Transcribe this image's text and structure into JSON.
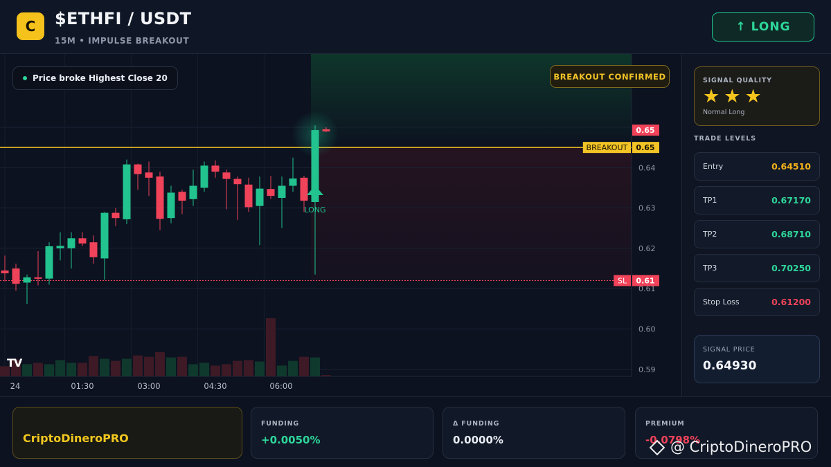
{
  "header": {
    "logo_letter": "C",
    "pair": "$ETHFI / USDT",
    "subtitle": "15M • IMPULSE BREAKOUT",
    "action_label": "↑ LONG"
  },
  "chart_overlay": {
    "info_pill": "Price broke Highest Close 20",
    "confirm_pill": "BREAKOUT CONFIRMED",
    "tv_logo": "TV"
  },
  "chart_data": {
    "type": "candlestick",
    "y_ticks": [
      "0.65",
      "0.64",
      "0.63",
      "0.62",
      "0.61",
      "0.60",
      "0.59"
    ],
    "x_ticks": [
      "24",
      "01:30",
      "03:00",
      "04:30",
      "06:00"
    ],
    "ylim": [
      0.5874,
      0.6584
    ],
    "breakout_level": 0.645,
    "stop_level": 0.612,
    "price_tags": [
      {
        "label": "",
        "value": "0.65",
        "color": "#f0435a",
        "price": 0.6493
      },
      {
        "label": "BREAKOUT",
        "value": "0.65",
        "color": "#f2c426",
        "price": 0.645
      },
      {
        "label": "SL",
        "value": "0.61",
        "color": "#f0435a",
        "price": 0.612
      }
    ],
    "signal_marker": {
      "label": "LONG",
      "candle_index": 28
    },
    "candles": [
      {
        "o": 0.6145,
        "h": 0.6182,
        "l": 0.6118,
        "c": 0.6138
      },
      {
        "o": 0.615,
        "h": 0.6162,
        "l": 0.6095,
        "c": 0.6112
      },
      {
        "o": 0.6115,
        "h": 0.6135,
        "l": 0.6062,
        "c": 0.6128
      },
      {
        "o": 0.6128,
        "h": 0.6193,
        "l": 0.6108,
        "c": 0.6125
      },
      {
        "o": 0.6125,
        "h": 0.6215,
        "l": 0.611,
        "c": 0.6205
      },
      {
        "o": 0.62,
        "h": 0.624,
        "l": 0.617,
        "c": 0.6206
      },
      {
        "o": 0.62,
        "h": 0.624,
        "l": 0.615,
        "c": 0.6225
      },
      {
        "o": 0.6225,
        "h": 0.624,
        "l": 0.6205,
        "c": 0.6212
      },
      {
        "o": 0.6215,
        "h": 0.6232,
        "l": 0.6162,
        "c": 0.6178
      },
      {
        "o": 0.6175,
        "h": 0.629,
        "l": 0.6122,
        "c": 0.6288
      },
      {
        "o": 0.6288,
        "h": 0.63,
        "l": 0.6255,
        "c": 0.6275
      },
      {
        "o": 0.6272,
        "h": 0.642,
        "l": 0.626,
        "c": 0.6408
      },
      {
        "o": 0.6408,
        "h": 0.641,
        "l": 0.6345,
        "c": 0.6384
      },
      {
        "o": 0.6388,
        "h": 0.6415,
        "l": 0.633,
        "c": 0.6375
      },
      {
        "o": 0.6378,
        "h": 0.639,
        "l": 0.6245,
        "c": 0.6273
      },
      {
        "o": 0.6275,
        "h": 0.6355,
        "l": 0.6262,
        "c": 0.6338
      },
      {
        "o": 0.634,
        "h": 0.6345,
        "l": 0.6285,
        "c": 0.6318
      },
      {
        "o": 0.6322,
        "h": 0.6395,
        "l": 0.6305,
        "c": 0.6355
      },
      {
        "o": 0.635,
        "h": 0.6415,
        "l": 0.634,
        "c": 0.6405
      },
      {
        "o": 0.6405,
        "h": 0.6418,
        "l": 0.6375,
        "c": 0.639
      },
      {
        "o": 0.6388,
        "h": 0.6395,
        "l": 0.6297,
        "c": 0.6372
      },
      {
        "o": 0.6372,
        "h": 0.6378,
        "l": 0.627,
        "c": 0.6359
      },
      {
        "o": 0.6358,
        "h": 0.6375,
        "l": 0.629,
        "c": 0.6302
      },
      {
        "o": 0.6305,
        "h": 0.6378,
        "l": 0.6208,
        "c": 0.6348
      },
      {
        "o": 0.6347,
        "h": 0.638,
        "l": 0.6322,
        "c": 0.633
      },
      {
        "o": 0.6325,
        "h": 0.6378,
        "l": 0.625,
        "c": 0.6355
      },
      {
        "o": 0.6355,
        "h": 0.6425,
        "l": 0.634,
        "c": 0.6373
      },
      {
        "o": 0.6375,
        "h": 0.638,
        "l": 0.629,
        "c": 0.6318
      },
      {
        "o": 0.6315,
        "h": 0.6505,
        "l": 0.6135,
        "c": 0.6493
      },
      {
        "o": 0.6495,
        "h": 0.65,
        "l": 0.6488,
        "c": 0.649
      }
    ],
    "volumes": [
      1.5,
      2.5,
      1.8,
      2.0,
      1.8,
      2.4,
      2.0,
      2.0,
      3.0,
      2.6,
      2.3,
      2.6,
      3.1,
      2.9,
      3.6,
      2.8,
      2.9,
      1.8,
      2.0,
      1.6,
      1.8,
      2.3,
      2.4,
      2.2,
      8.6,
      1.6,
      2.3,
      2.9,
      2.8,
      0.2
    ]
  },
  "side": {
    "quality_label": "SIGNAL QUALITY",
    "stars": 3,
    "star_glyph": "★",
    "quality_note": "Normal Long",
    "levels_title": "TRADE LEVELS",
    "levels": [
      {
        "name": "Entry",
        "value": "0.64510",
        "color": "#f5b21a"
      },
      {
        "name": "TP1",
        "value": "0.67170",
        "color": "#2ed69a"
      },
      {
        "name": "TP2",
        "value": "0.68710",
        "color": "#2ed69a"
      },
      {
        "name": "TP3",
        "value": "0.70250",
        "color": "#2ed69a"
      },
      {
        "name": "Stop Loss",
        "value": "0.61200",
        "color": "#f0435a"
      }
    ],
    "signal_price_label": "SIGNAL PRICE",
    "signal_price": "0.64930"
  },
  "footer": {
    "brand": "CriptoDineroPRO",
    "stats": [
      {
        "label": "FUNDING",
        "value": "+0.0050%",
        "color": "#2ed69a"
      },
      {
        "label": "Δ FUNDING",
        "value": "0.0000%",
        "color": "#e8ecf2"
      },
      {
        "label": "PREMIUM",
        "value": "-0.0798%",
        "color": "#f0435a"
      }
    ],
    "watermark": "@ CriptoDineroPRO"
  },
  "colors": {
    "up": "#22c38e",
    "down": "#f0435a",
    "accent": "#f2c426"
  }
}
